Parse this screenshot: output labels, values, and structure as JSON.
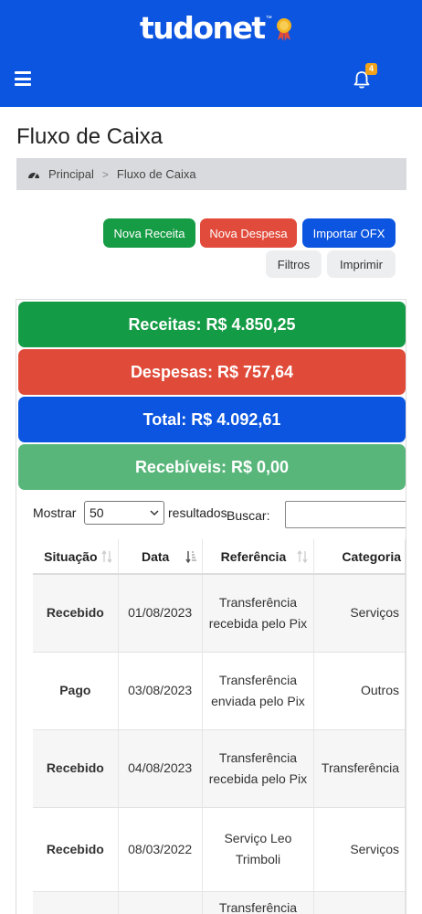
{
  "header": {
    "logo_text": "tudonet",
    "logo_tm": "™",
    "notification_count": "4",
    "brand_color": "#0b55e0"
  },
  "page": {
    "title": "Fluxo de Caixa"
  },
  "breadcrumb": {
    "home": "Principal",
    "separator": ">",
    "current": "Fluxo de Caixa"
  },
  "actions": {
    "nova_receita": "Nova Receita",
    "nova_despesa": "Nova Despesa",
    "importar_ofx": "Importar OFX",
    "filtros": "Filtros",
    "imprimir": "Imprimir"
  },
  "summary": {
    "receitas": "Receitas: R$ 4.850,25",
    "despesas": "Despesas: R$ 757,64",
    "total": "Total: R$ 4.092,61",
    "recebiveis": "Recebíveis: R$ 0,00"
  },
  "table_controls": {
    "show_label": "Mostrar",
    "page_size": "50",
    "results_label": "resultados",
    "search_label": "Buscar:",
    "search_value": ""
  },
  "table": {
    "columns": [
      "Situação",
      "Data",
      "Referência",
      "Categoria"
    ],
    "rows": [
      {
        "situacao": "Recebido",
        "data": "01/08/2023",
        "referencia": "Transferência recebida pelo Pix",
        "categoria": "Serviços"
      },
      {
        "situacao": "Pago",
        "data": "03/08/2023",
        "referencia": "Transferência enviada pelo Pix",
        "categoria": "Outros"
      },
      {
        "situacao": "Recebido",
        "data": "04/08/2023",
        "referencia": "Transferência recebida pelo Pix",
        "categoria": "Transferência"
      },
      {
        "situacao": "Recebido",
        "data": "08/03/2022",
        "referencia": "Serviço Leo Trimboli",
        "categoria": "Serviços"
      },
      {
        "situacao": "",
        "data": "",
        "referencia": "Transferência",
        "categoria": ""
      }
    ]
  },
  "colors": {
    "green": "#169c45",
    "red": "#e14b3b",
    "blue": "#0b55e0",
    "light_green": "#58b67a",
    "status_green": "#0d7a1d"
  }
}
